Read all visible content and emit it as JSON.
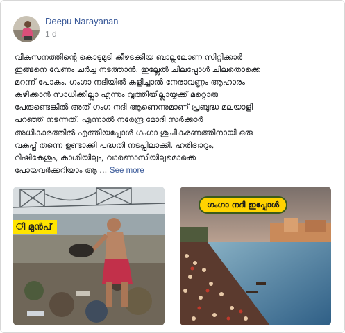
{
  "post": {
    "author": "Deepu Narayanan",
    "time": "1 d",
    "lines": [
      "വികസനത്തിന്റെ കൊടുമുടി കീഴടക്കിയ ബാല്ലലോണ സിറ്റിക്കാർ",
      "ഇങ്ങനെ വേണം ചർച്ച നടത്താൻ. ഇല്ലേൽ ചിലപ്പോൾ ചിലതൊക്കെ",
      "മറന്ന് പോകും. ഗംഗാ നദിയിൽ കുളിച്ചാൽ നേരാവണ്ണം ആഹാരം",
      "കഴിക്കാൻ സാധിക്കില്ലാ എന്നും വൃത്തിയില്ലായ്യക്ക് മറ്റൊരു",
      "പേരുണ്ടെങ്കിൽ അത് ഗംഗ നദി ആണെന്നുമാണ് പ്രബുദ്ധ മലയാളി",
      "പറഞ്ഞ് നടന്നത്. എന്നാൽ നരേന്ദ്ര മോദി സർക്കാർ",
      "അധികാരത്തിൽ എത്തിയപ്പോൾ ഗംഗാ ശുചീകരണത്തിനായി ഒരു",
      "വകുപ്പ് തന്നെ ഉണ്ടാക്കി പദ്ധതി നടപ്പിലാക്കി. ഹരിദ്വാറും,",
      "റിഷികേശും, കാശിയിലും, വാരണാസിയിലുമൊക്കെ"
    ],
    "last_line": "പോയവർക്കറിയാം ആ ...",
    "see_more": "See more"
  },
  "photos": {
    "left_caption": "ി മുൻപ്",
    "right_caption": "ഗംഗാ നദി ഇപ്പോൾ"
  }
}
